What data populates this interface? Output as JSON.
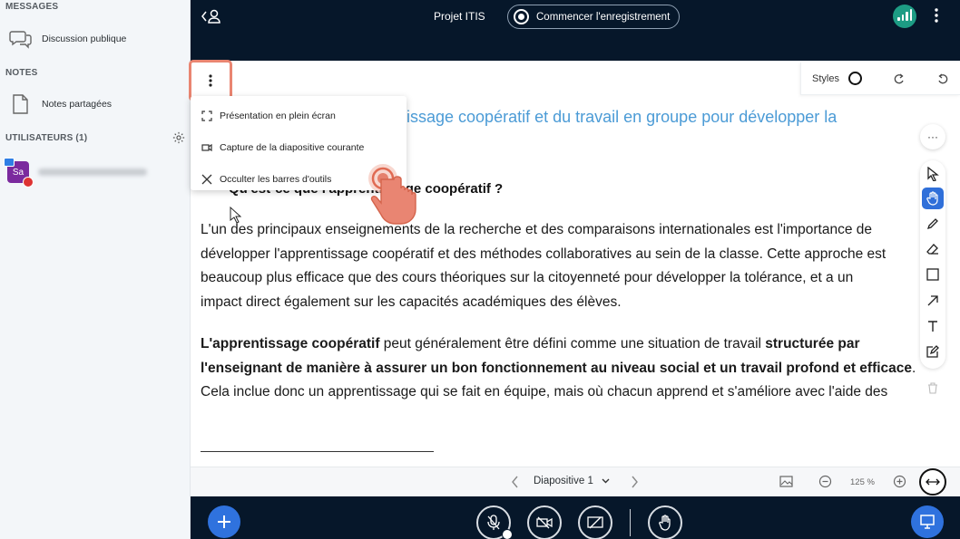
{
  "sidebar": {
    "messages_heading": "MESSAGES",
    "public_chat": "Discussion publique",
    "notes_heading": "NOTES",
    "shared_notes": "Notes partagées",
    "users_heading": "UTILISATEURS (1)",
    "user_initials": "Sa"
  },
  "topbar": {
    "title": "Projet ITIS",
    "record_label": "Commencer l'enregistrement"
  },
  "slide": {
    "title": "issage coopératif et du travail en groupe pour développer la",
    "question": "Qu'est-ce que l'apprentissage coopératif ?",
    "para1": [
      "L'un des principaux enseignements de la recherche et des comparaisons internationales est l'importance de",
      "développer l'apprentissage coopératif et des méthodes collaboratives au sein de la classe. Cette approche est",
      "beaucoup plus efficace que des cours théoriques sur la citoyenneté pour développer la tolérance, et a un",
      "impact direct également sur les capacités académiques des élèves."
    ],
    "para2_bold_a": "L'apprentissage coopératif",
    "para2_normal_a": " peut généralement être défini comme une situation de travail ",
    "para2_bold_b": "structurée par",
    "para2_line2": "l'enseignant de manière à assurer un bon fonctionnement au niveau social et un travail profond et efficace",
    "para2_line2_end": ".",
    "para2_line3": "Cela inclue donc un apprentissage qui se fait en équipe, mais où chacun apprend et s'améliore avec l'aide des"
  },
  "styles_panel": {
    "label": "Styles"
  },
  "options_menu": {
    "items": [
      "Présentation en plein écran",
      "Capture de la diapositive courante",
      "Occulter les barres d'outils"
    ]
  },
  "slide_controls": {
    "current_slide": "Diapositive 1",
    "zoom": "125 %"
  },
  "tools_more": "···"
}
